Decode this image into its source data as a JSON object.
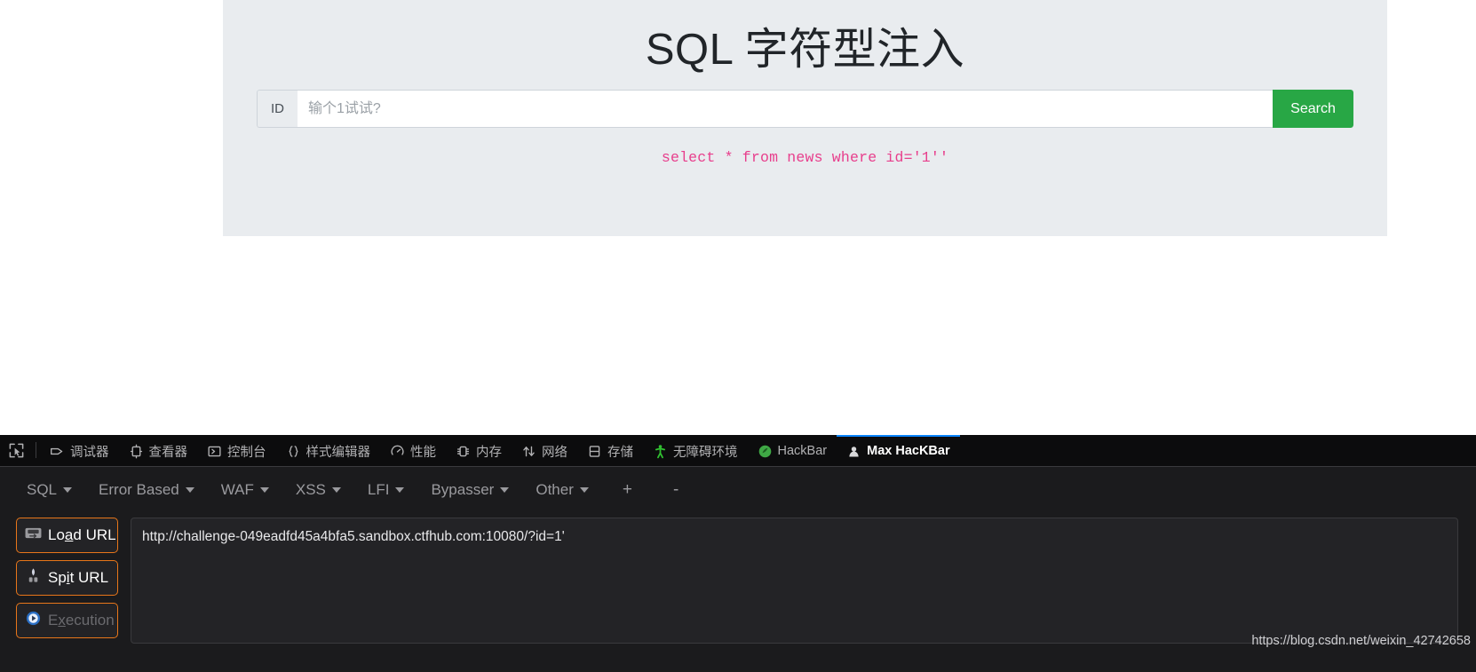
{
  "page": {
    "title": "SQL 字符型注入",
    "id_label": "ID",
    "id_placeholder": "输个1试试?",
    "id_value": "",
    "search_label": "Search",
    "sql_result": "select * from news where id='1''",
    "accent_green": "#28a745",
    "sql_color": "#e83e8c",
    "panel_bg": "#e9ecef"
  },
  "devtools": {
    "picker_icon": "element-picker-icon",
    "tabs": [
      {
        "label": "调试器",
        "icon": "debugger-icon",
        "active": false
      },
      {
        "label": "查看器",
        "icon": "inspector-icon",
        "active": false
      },
      {
        "label": "控制台",
        "icon": "console-icon",
        "active": false
      },
      {
        "label": "样式编辑器",
        "icon": "style-editor-icon",
        "active": false
      },
      {
        "label": "性能",
        "icon": "performance-icon",
        "active": false
      },
      {
        "label": "内存",
        "icon": "memory-icon",
        "active": false
      },
      {
        "label": "网络",
        "icon": "network-icon",
        "active": false
      },
      {
        "label": "存储",
        "icon": "storage-icon",
        "active": false
      },
      {
        "label": "无障碍环境",
        "icon": "accessibility-icon",
        "active": false
      },
      {
        "label": "HackBar",
        "icon": "hackbar-icon",
        "active": false
      },
      {
        "label": "Max HacKBar",
        "icon": "max-hackbar-icon",
        "active": true
      }
    ],
    "active_tab_color": "#0a84ff"
  },
  "hackbar": {
    "menus": [
      {
        "label": "SQL"
      },
      {
        "label": "Error Based"
      },
      {
        "label": "WAF"
      },
      {
        "label": "XSS"
      },
      {
        "label": "LFI"
      },
      {
        "label": "Bypasser"
      },
      {
        "label": "Other"
      }
    ],
    "add_label": "+",
    "remove_label": "-",
    "buttons": [
      {
        "label": "Load URL",
        "icon": "load-url-icon",
        "disabled": false,
        "accesskey": "a"
      },
      {
        "label": "Spit URL",
        "icon": "spit-url-icon",
        "disabled": false,
        "accesskey": "i"
      },
      {
        "label": "Execution",
        "icon": "execution-icon",
        "disabled": true,
        "accesskey": "x"
      }
    ],
    "url_value": "http://challenge-049eadfd45a4bfa5.sandbox.ctfhub.com:10080/?id=1'",
    "border_color": "#e8761a"
  },
  "watermark": "https://blog.csdn.net/weixin_42742658"
}
